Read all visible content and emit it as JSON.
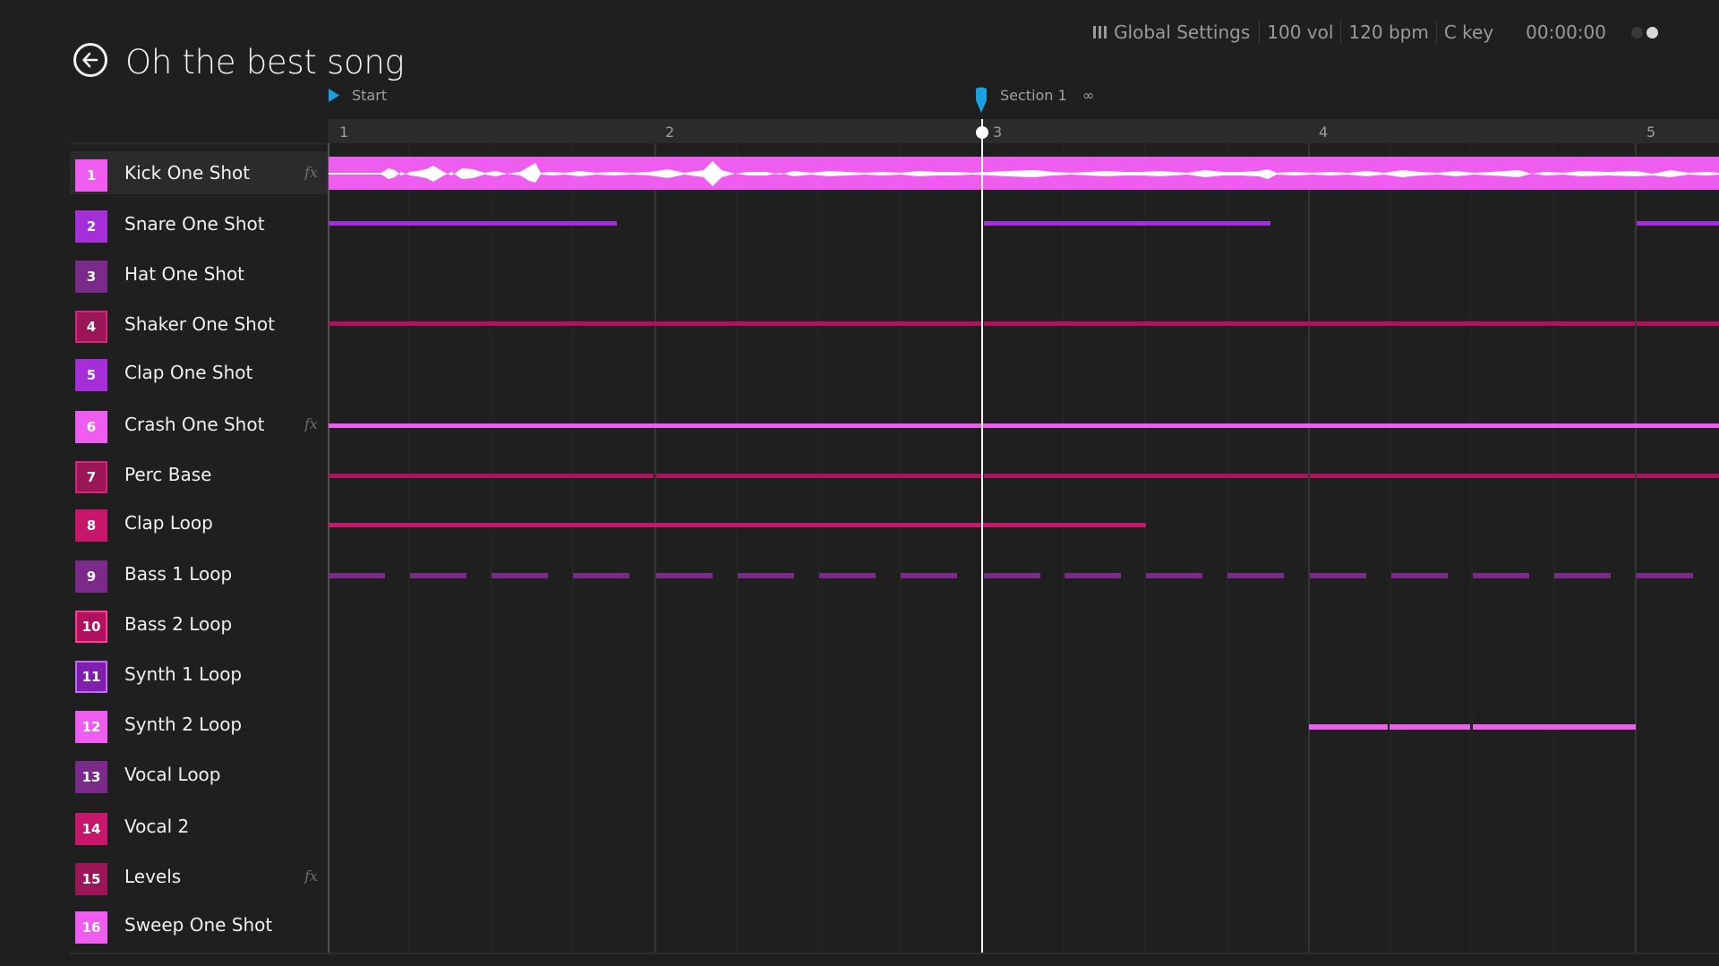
{
  "header": {
    "title": "Oh the best song",
    "global_settings": "Global Settings",
    "volume": "100 vol",
    "tempo": "120 bpm",
    "key": "C key",
    "time": "00:00:00"
  },
  "markers": {
    "start": "Start",
    "section": "Section 1",
    "loop_icon": "∞"
  },
  "ruler": {
    "bars": [
      "1",
      "2",
      "3",
      "4",
      "5"
    ]
  },
  "colors": {
    "pink_light": "#ee5cf0",
    "pink_light_border": "#f46df5",
    "violet": "#a52ed8",
    "purple_dark": "#7a2a88",
    "magenta_dark": "#9a1656",
    "magenta": "#c8166a",
    "magenta_mid": "#b0125e",
    "playhead": "#ffffff",
    "marker_blue": "#1ba1e2",
    "background": "#1f1f1f"
  },
  "tracks": [
    {
      "num": "1",
      "name": "Kick One Shot",
      "fx": "fx"
    },
    {
      "num": "2",
      "name": "Snare One Shot",
      "fx": ""
    },
    {
      "num": "3",
      "name": "Hat One Shot",
      "fx": ""
    },
    {
      "num": "4",
      "name": "Shaker One Shot",
      "fx": ""
    },
    {
      "num": "5",
      "name": "Clap One Shot",
      "fx": ""
    },
    {
      "num": "6",
      "name": "Crash One Shot",
      "fx": "fx"
    },
    {
      "num": "7",
      "name": "Perc Base",
      "fx": ""
    },
    {
      "num": "8",
      "name": "Clap Loop",
      "fx": ""
    },
    {
      "num": "9",
      "name": "Bass 1 Loop",
      "fx": ""
    },
    {
      "num": "10",
      "name": "Bass 2 Loop",
      "fx": ""
    },
    {
      "num": "11",
      "name": "Synth 1 Loop",
      "fx": ""
    },
    {
      "num": "12",
      "name": "Synth 2 Loop",
      "fx": ""
    },
    {
      "num": "13",
      "name": "Vocal Loop",
      "fx": ""
    },
    {
      "num": "14",
      "name": "Vocal 2",
      "fx": ""
    },
    {
      "num": "15",
      "name": "Levels",
      "fx": "fx"
    },
    {
      "num": "16",
      "name": "Sweep One Shot",
      "fx": ""
    }
  ]
}
